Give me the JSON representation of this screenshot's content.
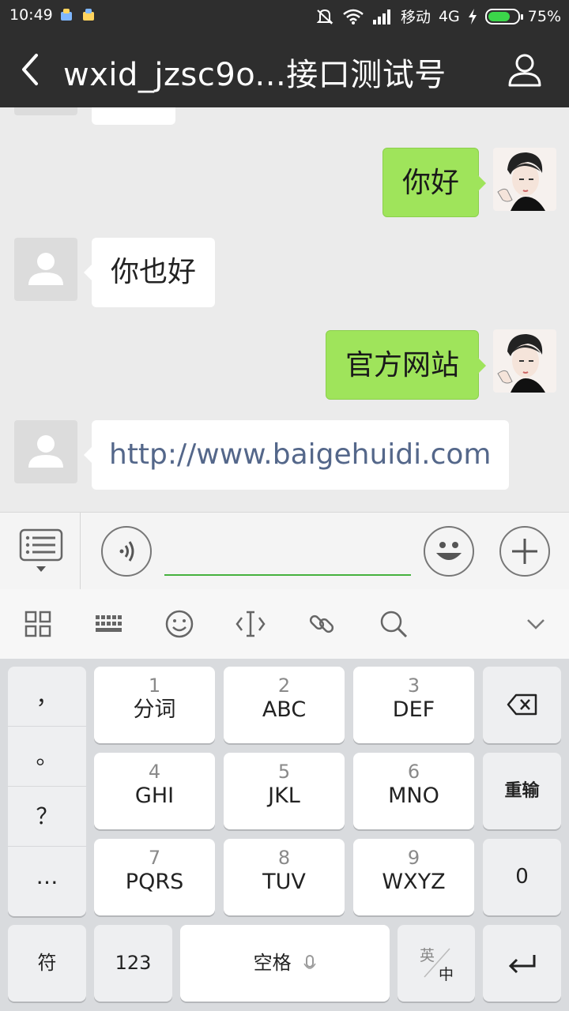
{
  "status_bar": {
    "time": "10:49",
    "carrier": "移动",
    "network": "4G",
    "battery": "75%",
    "battery_level": 0.75
  },
  "nav": {
    "title": "wxid_jzsc9o...接口测试号"
  },
  "messages": [
    {
      "side": "out",
      "text": "你好"
    },
    {
      "side": "in",
      "text": "你也好"
    },
    {
      "side": "out",
      "text": "官方网站"
    },
    {
      "side": "in",
      "text": "http://www.baigehuidi.com"
    }
  ],
  "input": {
    "value": ""
  },
  "keyboard": {
    "punctuation": [
      "，",
      "。",
      "？",
      "…"
    ],
    "keys": [
      {
        "num": "1",
        "label": "分词"
      },
      {
        "num": "2",
        "label": "ABC"
      },
      {
        "num": "3",
        "label": "DEF"
      },
      {
        "num": "4",
        "label": "GHI"
      },
      {
        "num": "5",
        "label": "JKL"
      },
      {
        "num": "6",
        "label": "MNO"
      },
      {
        "num": "7",
        "label": "PQRS"
      },
      {
        "num": "8",
        "label": "TUV"
      },
      {
        "num": "9",
        "label": "WXYZ"
      }
    ],
    "reinput": "重输",
    "zero": "0",
    "symbols": "符",
    "numbers": "123",
    "space": "空格",
    "lang_en": "英",
    "lang_zh": "中"
  },
  "colors": {
    "outgoing_bubble": "#9fe45b",
    "link": "#54678a",
    "nav_bg": "#2e2e2e"
  }
}
